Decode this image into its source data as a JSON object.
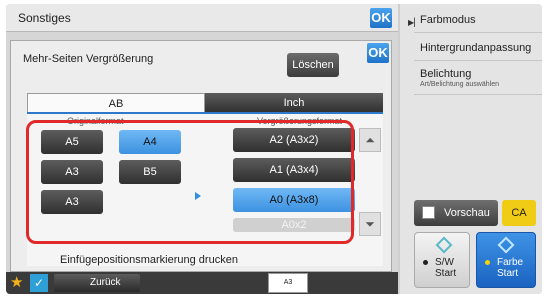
{
  "background_panel": {
    "title": "Sonstiges",
    "ok_label": "OK"
  },
  "side_panel": {
    "items": [
      {
        "label": "Farbmodus",
        "sub": ""
      },
      {
        "label": "Hintergrundanpassung",
        "sub": ""
      },
      {
        "label": "Belichtung",
        "sub": "Art/Belichtung auswählen"
      }
    ],
    "preview_label": "Vorschau",
    "ca_label": "CA",
    "sw_start": {
      "line1": "S/W",
      "line2": "Start"
    },
    "color_start": {
      "line1": "Farbe",
      "line2": "Start"
    }
  },
  "dialog": {
    "title": "Mehr-Seiten Vergrößerung",
    "ok_label": "OK",
    "clear_label": "Löschen",
    "tabs": [
      {
        "label": "AB",
        "selected": true
      },
      {
        "label": "Inch",
        "selected": false
      }
    ],
    "hidden_headers": {
      "original": "Originalformat",
      "target": "Vergrößerungsformat"
    },
    "original_sizes": [
      {
        "label": "A5",
        "selected": false
      },
      {
        "label": "A4",
        "selected": true
      },
      {
        "label": "A3",
        "selected": false
      },
      {
        "label": "B5",
        "selected": false
      },
      {
        "label": "A3",
        "selected": false
      }
    ],
    "target_sizes": [
      {
        "label": "A2 (A3x2)",
        "selected": false
      },
      {
        "label": "A1 (A3x4)",
        "selected": false
      },
      {
        "label": "A0 (A3x8)",
        "selected": true
      },
      {
        "label": "A0x2",
        "selected": false,
        "disabled": true
      }
    ],
    "checkbox_label": "Einfügepositionsmarkierung drucken"
  },
  "bottom_bar": {
    "back_label": "Zurück",
    "paper_label": "A3"
  },
  "colors": {
    "accent": "#2f79cc",
    "highlight": "#e02a2a",
    "selected": "#4a9ee6",
    "ca": "#f1cc16"
  }
}
